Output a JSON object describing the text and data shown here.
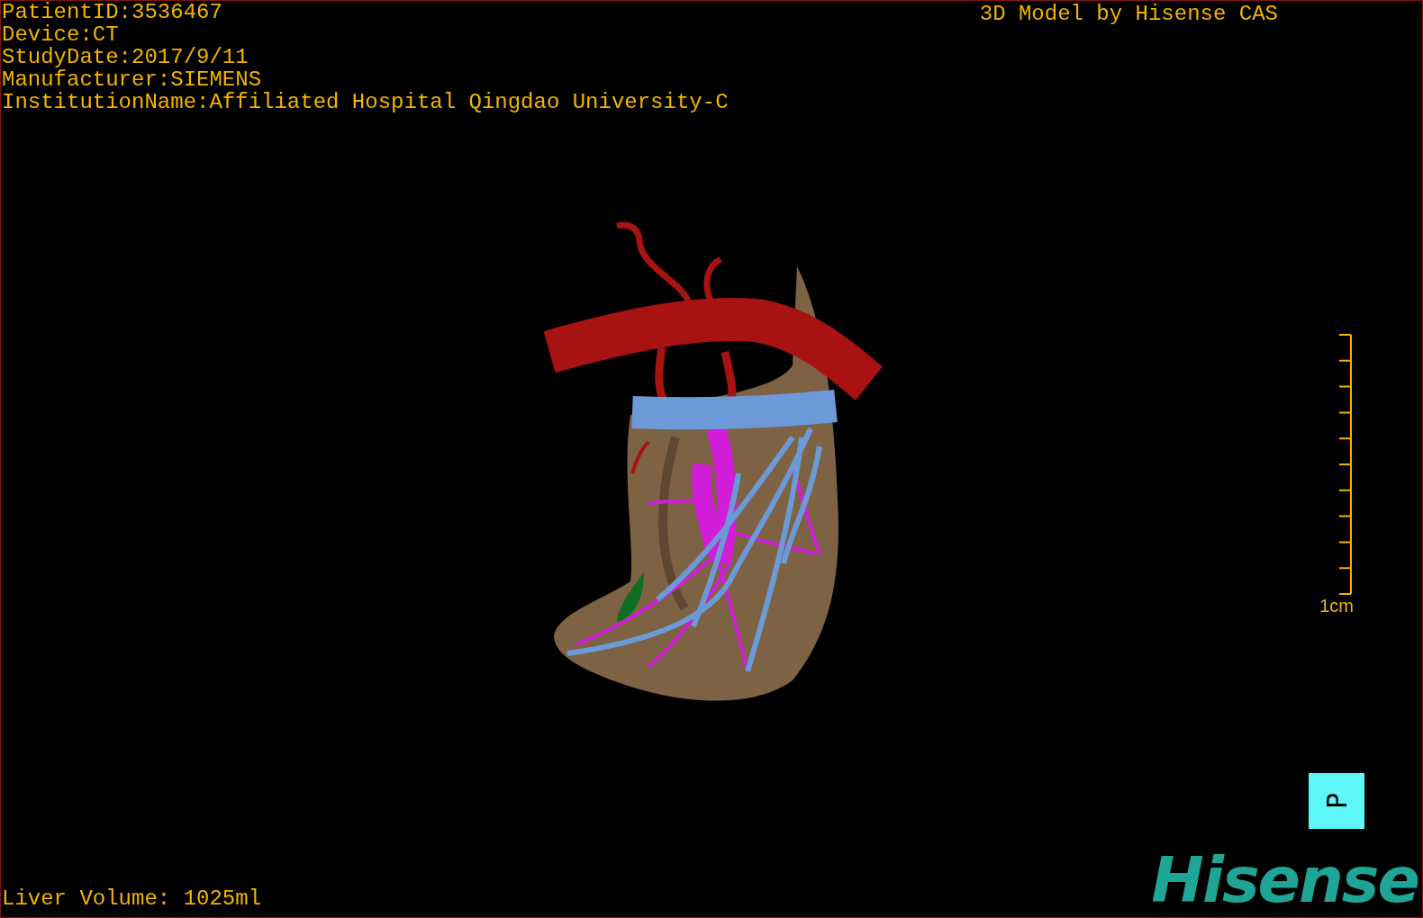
{
  "header": {
    "patient_info": [
      "PatientID:3536467",
      "Device:CT",
      "StudyDate:2017/9/11",
      "Manufacturer:SIEMENS",
      "InstitutionName:Affiliated Hospital Qingdao University-C"
    ],
    "credit": "3D Model by Hisense CAS"
  },
  "scale": {
    "label": "1cm"
  },
  "orientation_cube": {
    "label": "P"
  },
  "liver_volume": "Liver Volume: 1025ml",
  "logo": "Hisense"
}
